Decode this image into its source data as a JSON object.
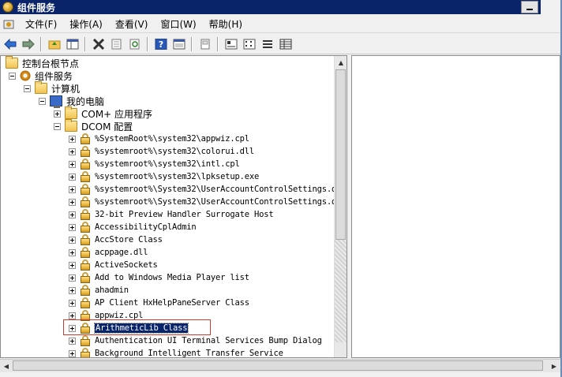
{
  "window": {
    "title": "组件服务"
  },
  "menu": [
    "文件(F)",
    "操作(A)",
    "查看(V)",
    "窗口(W)",
    "帮助(H)"
  ],
  "toolbar": [
    "back-icon",
    "forward-icon",
    "up-folder-icon",
    "show-tree-icon",
    "delete-icon",
    "properties-icon",
    "refresh-icon",
    "help-icon",
    "view-icon",
    "export-icon",
    "large-icons-icon",
    "small-icons-icon",
    "list-view-icon",
    "detail-view-icon"
  ],
  "tree": {
    "root": "控制台根节点",
    "component_services": "组件服务",
    "computers": "计算机",
    "my_computer": "我的电脑",
    "com_apps": "COM+ 应用程序",
    "dcom_config": "DCOM 配置",
    "dcom_items": [
      "%SystemRoot%\\system32\\appwiz.cpl",
      "%systemroot%\\system32\\colorui.dll",
      "%systemroot%\\system32\\intl.cpl",
      "%systemroot%\\system32\\lpksetup.exe",
      "%systemroot%\\System32\\UserAccountControlSettings.d",
      "%systemroot%\\System32\\UserAccountControlSettings.d",
      "32-bit Preview Handler Surrogate Host",
      "AccessibilityCplAdmin",
      "AccStore Class",
      "acppage.dll",
      "ActiveSockets",
      "Add to Windows Media Player list",
      "ahadmin",
      "AP Client HxHelpPaneServer Class",
      "appwiz.cpl",
      "ArithmeticLib Class",
      "Authentication UI Terminal Services Bump Dialog",
      "Background Intelligent Transfer Service"
    ],
    "selected_item": "ArithmeticLib Class"
  }
}
